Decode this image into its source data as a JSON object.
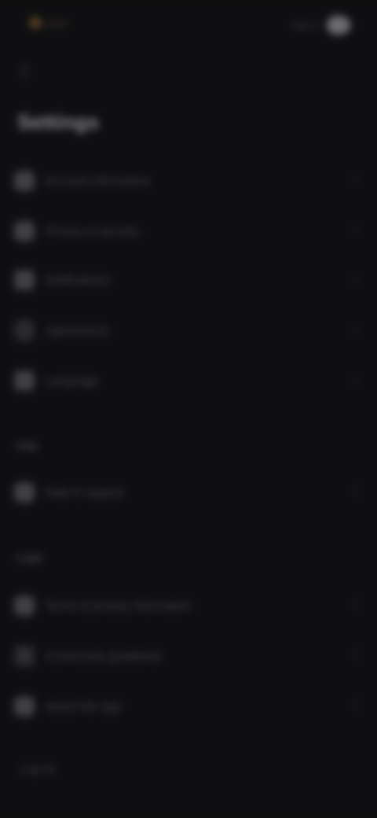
{
  "header": {
    "logo_text": "Kiwi",
    "right_label": "Sign in"
  },
  "page": {
    "title": "Settings"
  },
  "sections": {
    "main_items": [
      {
        "label": "Account information",
        "icon": "user-icon"
      },
      {
        "label": "Privacy & security",
        "icon": "lock-icon"
      },
      {
        "label": "Notifications",
        "icon": "bell-icon"
      },
      {
        "label": "Appearance",
        "icon": "palette-icon"
      },
      {
        "label": "Language",
        "icon": "globe-icon"
      }
    ],
    "help_label": "Help",
    "help_items": [
      {
        "label": "Help & support",
        "icon": "help-icon"
      }
    ],
    "legal_label": "Legal",
    "legal_items": [
      {
        "label": "Terms & privacy information",
        "icon": "document-icon"
      },
      {
        "label": "Community guidelines",
        "icon": "people-icon"
      },
      {
        "label": "About this app",
        "icon": "info-icon"
      }
    ],
    "footer_link": "Log out"
  },
  "colors": {
    "background": "#0f0f11",
    "icon_tile": "#3f3f44",
    "accent": "#5a4322"
  }
}
